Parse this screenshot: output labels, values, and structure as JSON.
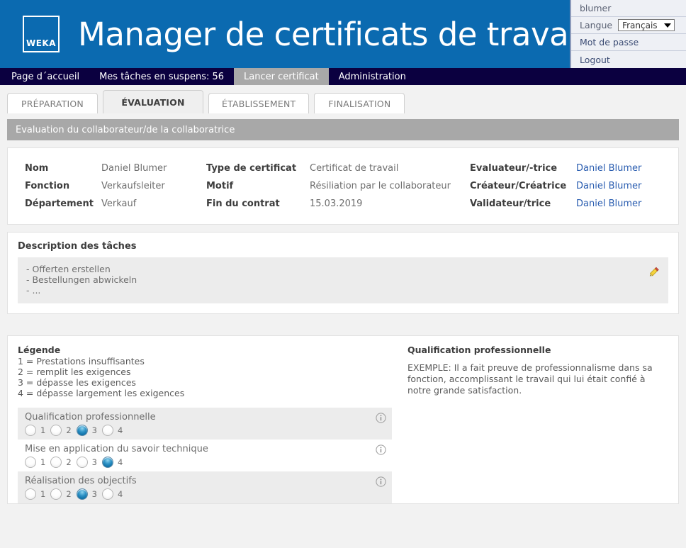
{
  "header": {
    "logo_text": "WEKA",
    "title": "Manager de certificats de travail",
    "brand_color": "#0b6ab0"
  },
  "user_panel": {
    "username": "blumer",
    "language_label": "Langue",
    "language_value": "Français",
    "password_label": "Mot de passe",
    "logout_label": "Logout"
  },
  "navbar": {
    "items": [
      {
        "label": "Page d´accueil",
        "active": false
      },
      {
        "label": "Mes tâches en suspens: 56",
        "active": false
      },
      {
        "label": "Lancer certificat",
        "active": true
      },
      {
        "label": "Administration",
        "active": false
      }
    ],
    "background_color": "#0b0040",
    "active_color": "#a8a8a8"
  },
  "tabs": [
    {
      "label": "PRÉPARATION",
      "active": false
    },
    {
      "label": "ÉVALUATION",
      "active": true
    },
    {
      "label": "ÉTABLISSEMENT",
      "active": false
    },
    {
      "label": "FINALISATION",
      "active": false
    }
  ],
  "section_bar": {
    "title": "Evaluation du collaborateur/de la collaboratrice",
    "color": "#a8a8a8"
  },
  "info": {
    "rows": [
      {
        "label1": "Nom",
        "value1": "Daniel Blumer",
        "label2": "Type de certificat",
        "value2": "Certificat de travail",
        "label3": "Evaluateur/-trice",
        "value3": "Daniel Blumer"
      },
      {
        "label1": "Fonction",
        "value1": "Verkaufsleiter",
        "label2": "Motif",
        "value2": "Résiliation par le collaborateur",
        "label3": "Créateur/Créatrice",
        "value3": "Daniel Blumer"
      },
      {
        "label1": "Département",
        "value1": "Verkauf",
        "label2": "Fin du contrat",
        "value2": "15.03.2019",
        "label3": "Validateur/trice",
        "value3": "Daniel Blumer"
      }
    ],
    "link_color": "#2a5db0"
  },
  "description": {
    "title": "Description des tâches",
    "lines": [
      "- Offerten erstellen",
      "- Bestellungen abwickeln",
      "- ..."
    ],
    "edit_icon": "pencil-icon"
  },
  "legend": {
    "title": "Légende",
    "lines": [
      "1 = Prestations insuffisantes",
      "2 = remplit les exigences",
      "3 = dépasse les exigences",
      "4 = dépasse largement les exigences"
    ]
  },
  "criteria": {
    "scale": [
      "1",
      "2",
      "3",
      "4"
    ],
    "items": [
      {
        "label": "Qualification professionnelle",
        "selected": 3,
        "shaded": true
      },
      {
        "label": "Mise en application du savoir technique",
        "selected": 4,
        "shaded": false
      },
      {
        "label": "Réalisation des objectifs",
        "selected": 3,
        "shaded": true
      }
    ]
  },
  "example": {
    "title": "Qualification professionnelle",
    "body": "EXEMPLE: Il a fait preuve de professionnalisme dans sa fonction, accomplissant le travail qui lui était confié à notre grande satisfaction."
  }
}
